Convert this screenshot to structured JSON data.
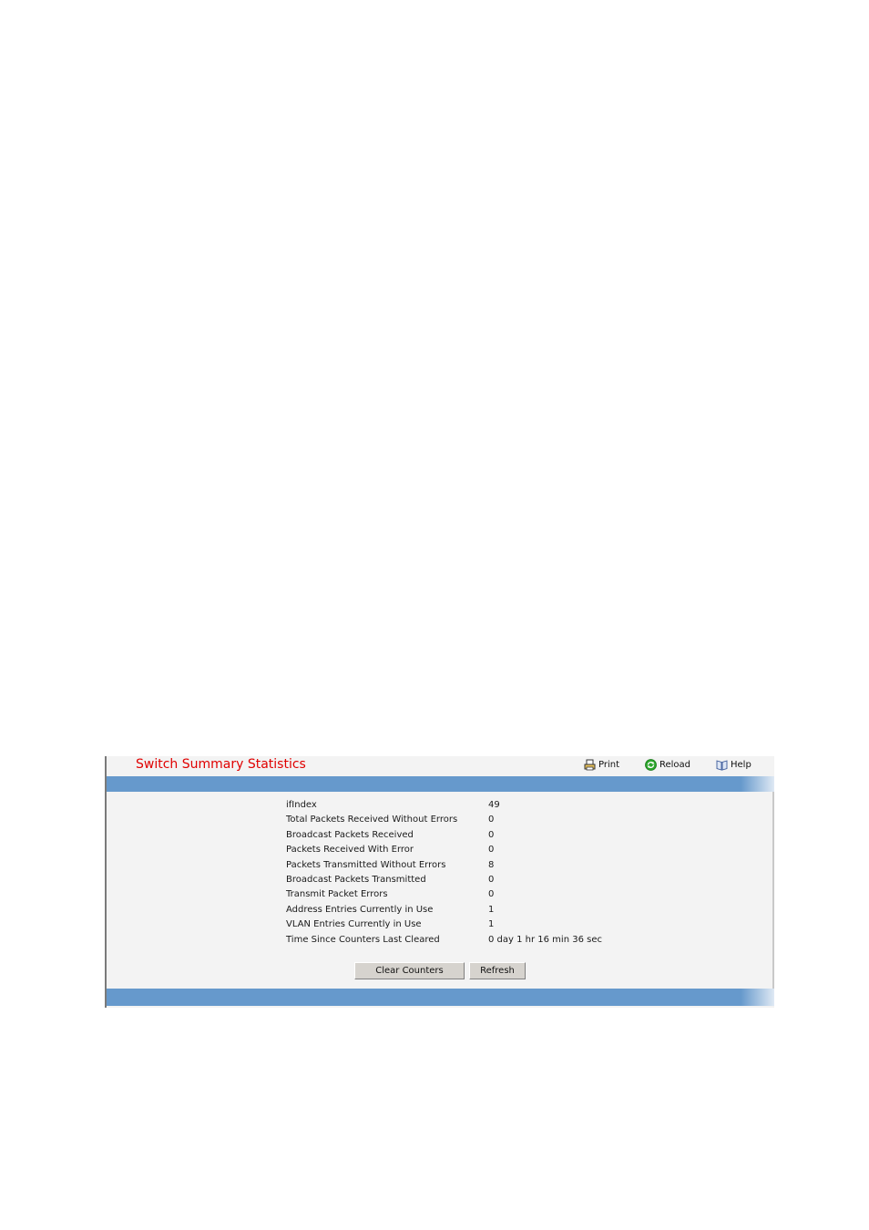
{
  "header": {
    "title": "Switch Summary Statistics",
    "tools": [
      {
        "label": "Print",
        "icon": "printer-icon"
      },
      {
        "label": "Reload",
        "icon": "reload-icon"
      },
      {
        "label": "Help",
        "icon": "help-book-icon"
      }
    ]
  },
  "stats": [
    {
      "label": "ifIndex",
      "value": "49"
    },
    {
      "label": "Total Packets Received Without Errors",
      "value": "0"
    },
    {
      "label": "Broadcast Packets Received",
      "value": "0"
    },
    {
      "label": "Packets Received With Error",
      "value": "0"
    },
    {
      "label": "Packets Transmitted Without Errors",
      "value": "8"
    },
    {
      "label": "Broadcast Packets Transmitted",
      "value": "0"
    },
    {
      "label": "Transmit Packet Errors",
      "value": "0"
    },
    {
      "label": "Address Entries Currently in Use",
      "value": "1"
    },
    {
      "label": "VLAN Entries Currently in Use",
      "value": "1"
    },
    {
      "label": "Time Since Counters Last Cleared",
      "value": "0 day 1 hr 16 min 36 sec"
    }
  ],
  "buttons": {
    "clear_counters": "Clear Counters",
    "refresh": "Refresh"
  },
  "colors": {
    "title": "#e00000",
    "band": "#6699cc",
    "panel_bg": "#f3f3f3"
  }
}
